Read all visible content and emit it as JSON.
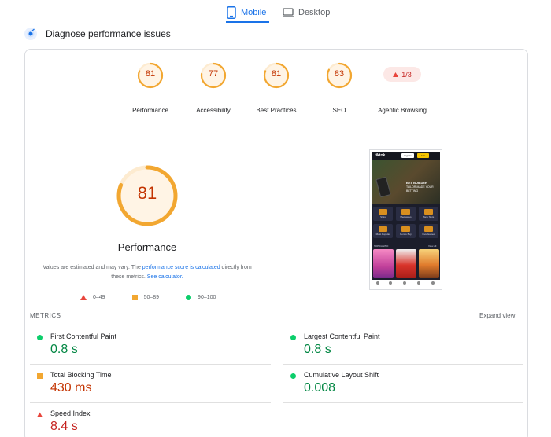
{
  "tabs": {
    "mobile_label": "Mobile",
    "desktop_label": "Desktop",
    "active": "Mobile"
  },
  "diagnose": {
    "title": "Diagnose performance issues"
  },
  "categories": [
    {
      "score": "81",
      "label": "Performance",
      "status": "average",
      "fraction": 0.81
    },
    {
      "score": "77",
      "label": "Accessibility",
      "status": "average",
      "fraction": 0.77
    },
    {
      "score": "81",
      "label": "Best Practices",
      "status": "average",
      "fraction": 0.81
    },
    {
      "score": "83",
      "label": "SEO",
      "status": "average",
      "fraction": 0.83
    },
    {
      "score": "1/3",
      "label": "Agentic Browsing",
      "status": "fail"
    }
  ],
  "main_gauge": {
    "score": "81",
    "fraction": 0.81,
    "title": "Performance"
  },
  "note": {
    "part1": "Values are estimated and may vary. The ",
    "link1": "performance score is calculated",
    "part2": " directly from these metrics. ",
    "link2": "See calculator."
  },
  "legend": {
    "fail": "0–49",
    "average": "50–89",
    "pass": "90–100"
  },
  "screenshot": {
    "logo": "tiktok",
    "btn_signin": "Sign In",
    "btn_join": "Join",
    "hero_line1": "BET BUILDER",
    "hero_line2": "TAILOR-MADE YOUR BETTING",
    "tiles": [
      "Slots",
      "Megaways",
      "New Slots",
      "Most Popular",
      "Bonus Buy",
      "Live Games"
    ],
    "section": "TOP CASINO",
    "section_link": "View all"
  },
  "metrics_section": {
    "header": "METRICS",
    "expand": "Expand view"
  },
  "metrics": [
    {
      "name": "First Contentful Paint",
      "value": "0.8 s",
      "status": "pass"
    },
    {
      "name": "Largest Contentful Paint",
      "value": "0.8 s",
      "status": "pass"
    },
    {
      "name": "Total Blocking Time",
      "value": "430 ms",
      "status": "average"
    },
    {
      "name": "Cumulative Layout Shift",
      "value": "0.008",
      "status": "pass"
    },
    {
      "name": "Speed Index",
      "value": "8.4 s",
      "status": "fail"
    }
  ],
  "colors": {
    "accent": "#1a73e8",
    "average": "#f2a731",
    "average_text": "#c33300",
    "pass": "#0cce6b",
    "pass_text": "#018642",
    "fail": "#e8453c",
    "fail_text": "#c5221f"
  }
}
